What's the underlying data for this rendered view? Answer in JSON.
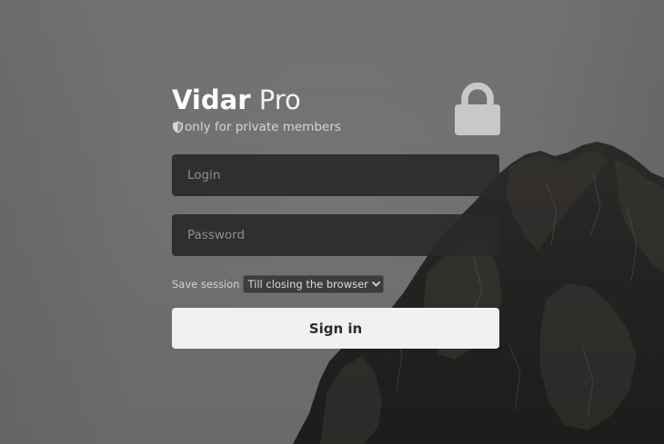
{
  "brand": {
    "name_bold": "Vidar",
    "name_light": "Pro",
    "tagline": "only for private members"
  },
  "form": {
    "login_placeholder": "Login",
    "password_placeholder": "Password",
    "save_session_label": "Save session",
    "save_session_value": "Till closing the browser",
    "signin_label": "Sign in"
  },
  "icons": {
    "tagline": "shield-icon",
    "corner": "lock-icon",
    "select": "chevron-down-icon"
  },
  "colors": {
    "background": "#6f6f6f",
    "field_background": "#2a2a2a",
    "button_background": "#f1f1f2",
    "button_text": "#2c2c2c"
  }
}
